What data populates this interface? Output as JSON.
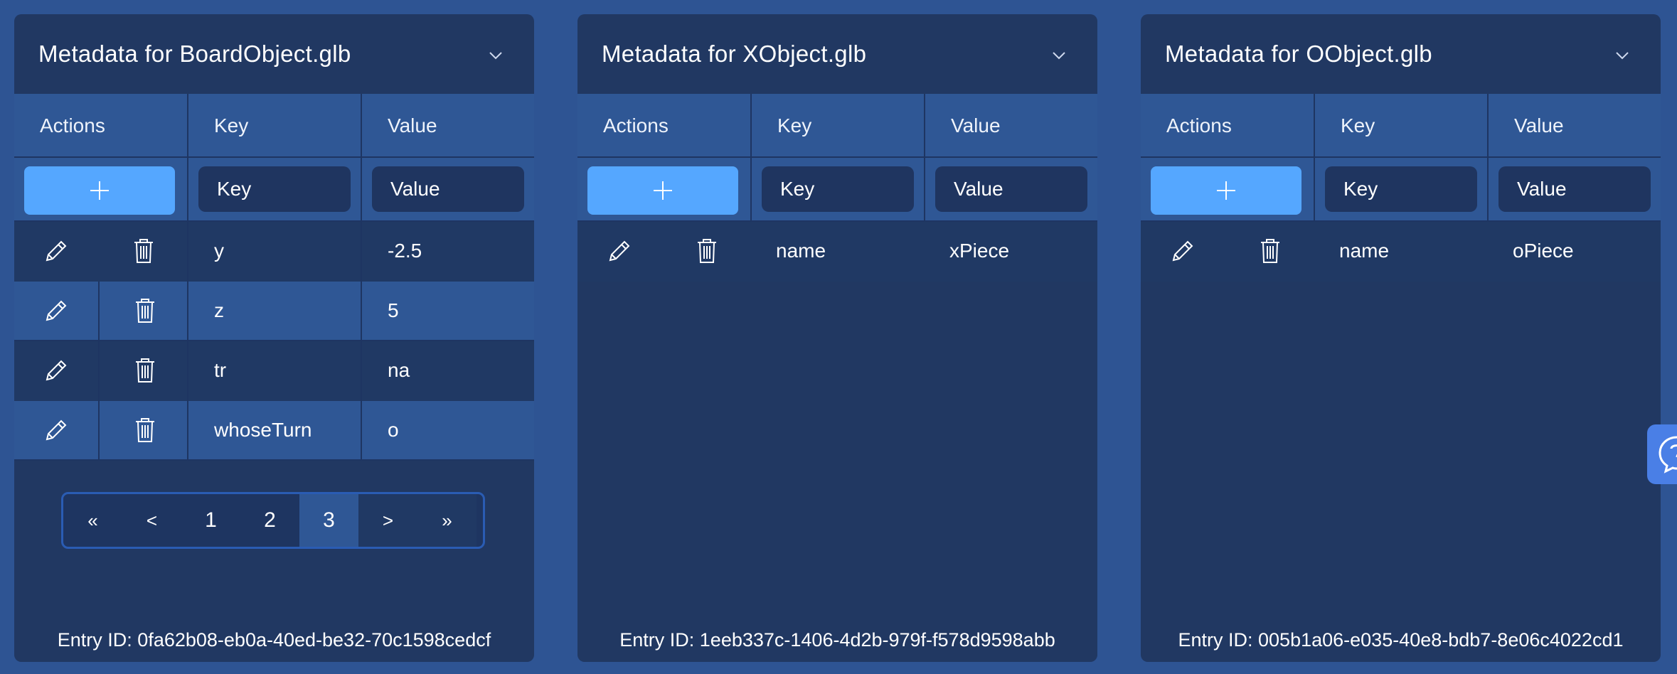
{
  "panels": [
    {
      "title": "Metadata for BoardObject.glb",
      "headers": {
        "actions": "Actions",
        "key": "Key",
        "value": "Value"
      },
      "inputs": {
        "key_placeholder": "Key",
        "value_placeholder": "Value"
      },
      "rows": [
        {
          "key": "y",
          "value": "-2.5"
        },
        {
          "key": "z",
          "value": "5"
        },
        {
          "key": "tr",
          "value": "na"
        },
        {
          "key": "whoseTurn",
          "value": "o"
        }
      ],
      "pagination": {
        "first": "«",
        "prev": "<",
        "pages": [
          "1",
          "2",
          "3"
        ],
        "current_page": "3",
        "next": ">",
        "last": "»"
      },
      "entry_id": "Entry ID: 0fa62b08-eb0a-40ed-be32-70c1598cedcf"
    },
    {
      "title": "Metadata for XObject.glb",
      "headers": {
        "actions": "Actions",
        "key": "Key",
        "value": "Value"
      },
      "inputs": {
        "key_placeholder": "Key",
        "value_placeholder": "Value"
      },
      "rows": [
        {
          "key": "name",
          "value": "xPiece"
        }
      ],
      "entry_id": "Entry ID: 1eeb337c-1406-4d2b-979f-f578d9598abb"
    },
    {
      "title": "Metadata for OObject.glb",
      "headers": {
        "actions": "Actions",
        "key": "Key",
        "value": "Value"
      },
      "inputs": {
        "key_placeholder": "Key",
        "value_placeholder": "Value"
      },
      "rows": [
        {
          "key": "name",
          "value": "oPiece"
        }
      ],
      "entry_id": "Entry ID: 005b1a06-e035-40e8-bdb7-8e06c4022cd1"
    }
  ],
  "icons": {
    "collapse": "chevron-down-icon",
    "add": "plus-icon",
    "edit": "pencil-icon",
    "delete": "trash-icon",
    "help": "question-icon"
  },
  "colors": {
    "page_bg": "#2e5493",
    "panel_bg": "#213862",
    "row_light": "#2f5795",
    "accent_button": "#55a7ff",
    "pager_border": "#2a5cb3",
    "help_button": "#4a7fe6"
  }
}
